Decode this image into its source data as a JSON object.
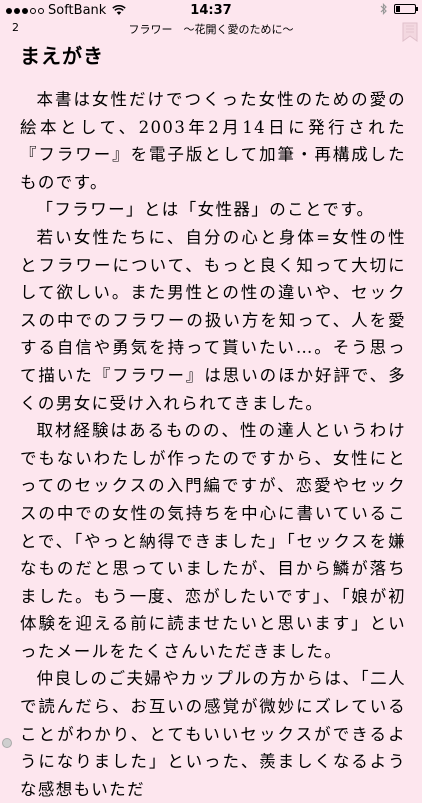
{
  "status_bar": {
    "carrier": "SoftBank",
    "time": "14:37"
  },
  "header": {
    "page_number": "2",
    "book_title": "フラワー　～花開く愛のために～"
  },
  "chapter": {
    "title": "まえがき"
  },
  "paragraphs": [
    "本書は女性だけでつくった女性のための愛の絵本として、2003年2月14日に発行された『フラワー』を電子版として加筆・再構成したものです。",
    "「フラワー」とは「女性器」のことです。",
    "若い女性たちに、自分の心と身体=女性の性とフラワーについて、もっと良く知って大切にして欲しい。また男性との性の違いや、セックスの中でのフラワーの扱い方を知って、人を愛する自信や勇気を持って貰いたい…。そう思って描いた『フラワー』は思いのほか好評で、多くの男女に受け入れられてきました。",
    "取材経験はあるものの、性の達人というわけでもないわたしが作ったのですから、女性にとってのセックスの入門編ですが、恋愛やセックスの中での女性の気持ちを中心に書いていることで、「やっと納得できました」「セックスを嫌なものだと思っていましたが、目から鱗が落ちました。もう一度、恋がしたいです」、「娘が初体験を迎える前に読ませたいと思います」といったメールをたくさんいただきました。",
    "仲良しのご夫婦やカップルの方からは、「二人で読んだら、お互いの感覚が微妙にズレていることがわかり、とてもいいセックスができるようになりました」といった、羨ましくなるような感想もいただ"
  ]
}
